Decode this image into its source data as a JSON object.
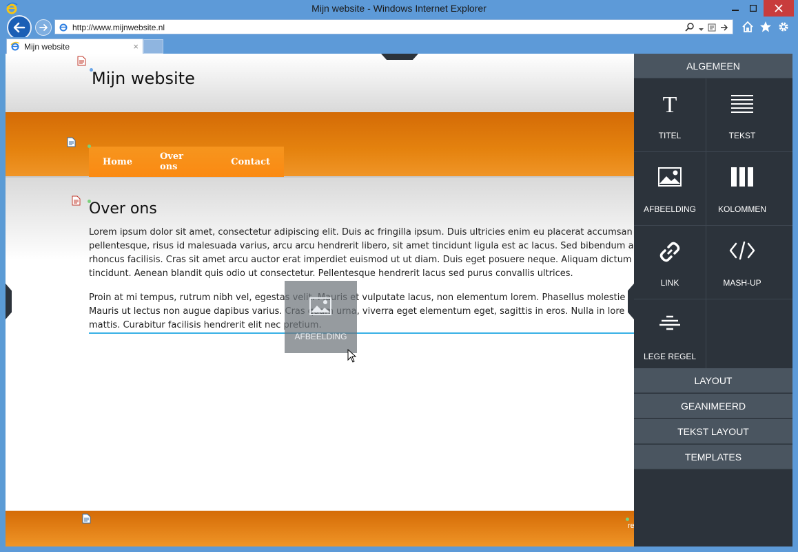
{
  "window": {
    "title": "Mijn website - Windows Internet Explorer"
  },
  "browser": {
    "url": "http://www.mijnwebsite.nl",
    "tab_title": "Mijn website",
    "tab_close": "×"
  },
  "site": {
    "title": "Mijn website",
    "menu": [
      "Home",
      "Over ons",
      "Contact"
    ],
    "section_heading": "Over ons",
    "paragraph1": [
      "Lorem ipsum dolor sit amet, consectetur adipiscing elit. Duis ac fringilla ipsum. Duis ultricies enim eu placerat accumsan",
      "pellentesque, risus id malesuada varius, arcu arcu hendrerit libero, sit amet tincidunt ligula est ac lacus. Sed bibendum a",
      "rhoncus facilisis. Cras sit amet arcu auctor erat imperdiet euismod ut ut diam. Duis eget posuere neque. Aliquam dictum",
      "tincidunt. Aenean blandit quis odio ut consectetur. Pellentesque hendrerit lacus sed purus convallis ultrices."
    ],
    "paragraph2": [
      "Proin at mi tempus, rutrum nibh vel, egestas velit. Mauris et vulputate lacus, non elementum lorem. Phasellus molestie",
      "Mauris ut lectus non augue dapibus varius. Cras quam urna, viverra eget elementum eget, sagittis in eros. Nulla in lore",
      "mattis. Curabitur facilisis hendrerit elit nec pretium."
    ],
    "drag_ghost_label": "AFBEELDING",
    "footer_text": "re"
  },
  "panel": {
    "section_general": "ALGEMEEN",
    "items": [
      {
        "label": "TITEL",
        "icon": "title-icon"
      },
      {
        "label": "TEKST",
        "icon": "text-icon"
      },
      {
        "label": "AFBEELDING",
        "icon": "image-icon"
      },
      {
        "label": "KOLOMMEN",
        "icon": "columns-icon"
      },
      {
        "label": "LINK",
        "icon": "link-icon"
      },
      {
        "label": "MASH-UP",
        "icon": "code-icon"
      },
      {
        "label": "LEGE REGEL",
        "icon": "empty-line-icon"
      }
    ],
    "sections": [
      "LAYOUT",
      "GEANIMEERD",
      "TEKST LAYOUT",
      "TEMPLATES"
    ]
  },
  "colors": {
    "chrome": "#5d9ad8",
    "orange": "#e5830f",
    "panel": "#2c333b",
    "panel_header": "#4a5560",
    "drop_indicator": "#39b1e6"
  }
}
